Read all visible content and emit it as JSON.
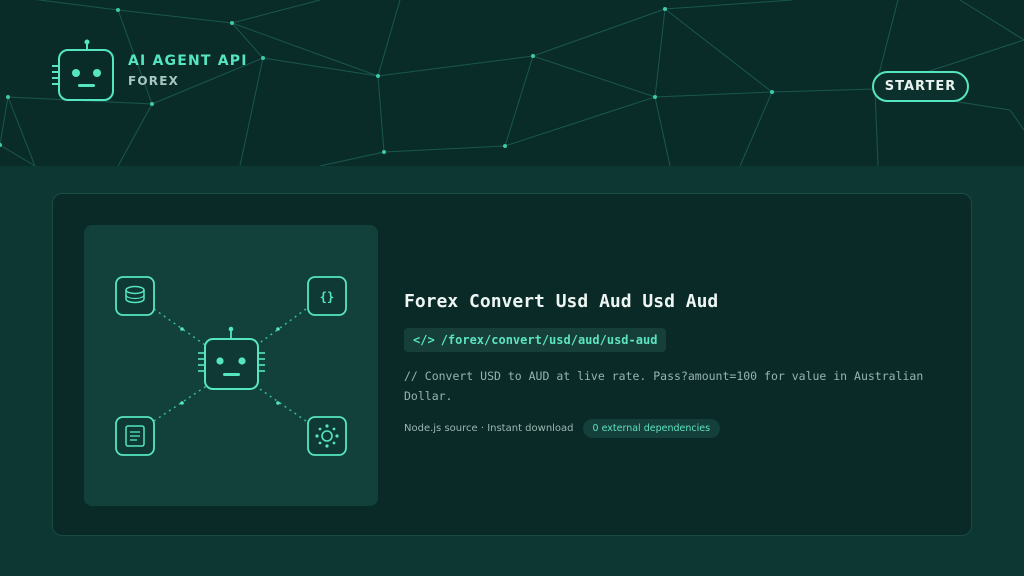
{
  "header": {
    "brand_title": "AI AGENT API",
    "brand_subtitle": "FOREX",
    "plan_badge": "STARTER",
    "logo_icon": "robot-icon"
  },
  "endpoint": {
    "title": "Forex Convert Usd Aud Usd Aud",
    "path_prefix": "</>",
    "path": "/forex/convert/usd/aud/usd-aud",
    "description": "// Convert USD to AUD at live rate. Pass?amount=100 for value in Australian Dollar.",
    "meta": "Node.js source · Instant download",
    "dependencies_badge": "0 external dependencies"
  },
  "illustration": {
    "nodes": [
      "database-icon",
      "code-braces-icon",
      "document-icon",
      "network-hub-icon"
    ],
    "center": "robot-icon"
  },
  "colors": {
    "accent": "#55e6c1",
    "header_bg": "#0a2c29",
    "page_bg": "#0c3733",
    "card_bg": "#0a2a28"
  }
}
